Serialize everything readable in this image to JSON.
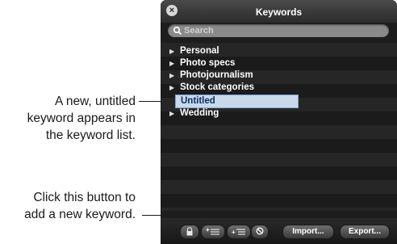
{
  "callouts": {
    "new_keyword": [
      "A new, untitled",
      "keyword appears in",
      "the keyword list."
    ],
    "add_button": [
      "Click this button to",
      "add a new keyword."
    ]
  },
  "panel": {
    "title": "Keywords",
    "close_icon": "close-x-icon",
    "search": {
      "placeholder": "Search",
      "value": "",
      "icon": "magnifier-icon"
    }
  },
  "keywords": [
    {
      "label": "Personal",
      "expandable": true,
      "selected": false
    },
    {
      "label": "Photo specs",
      "expandable": true,
      "selected": false
    },
    {
      "label": "Photojournalism",
      "expandable": true,
      "selected": false
    },
    {
      "label": "Stock categories",
      "expandable": true,
      "selected": false
    },
    {
      "label": "Untitled",
      "expandable": false,
      "selected": true
    },
    {
      "label": "Wedding",
      "expandable": true,
      "selected": false
    }
  ],
  "toolbar": {
    "lock_icon": "lock-icon",
    "add_keyword_icon": "add-keyword-icon",
    "add_subkeyword_icon": "add-subkeyword-icon",
    "remove_icon": "remove-circle-icon",
    "import_label": "Import...",
    "export_label": "Export..."
  },
  "colors": {
    "panel_bg": "#1d1d1d",
    "selection_bg": "#c9d8ea",
    "selection_text": "#0b2f68"
  }
}
